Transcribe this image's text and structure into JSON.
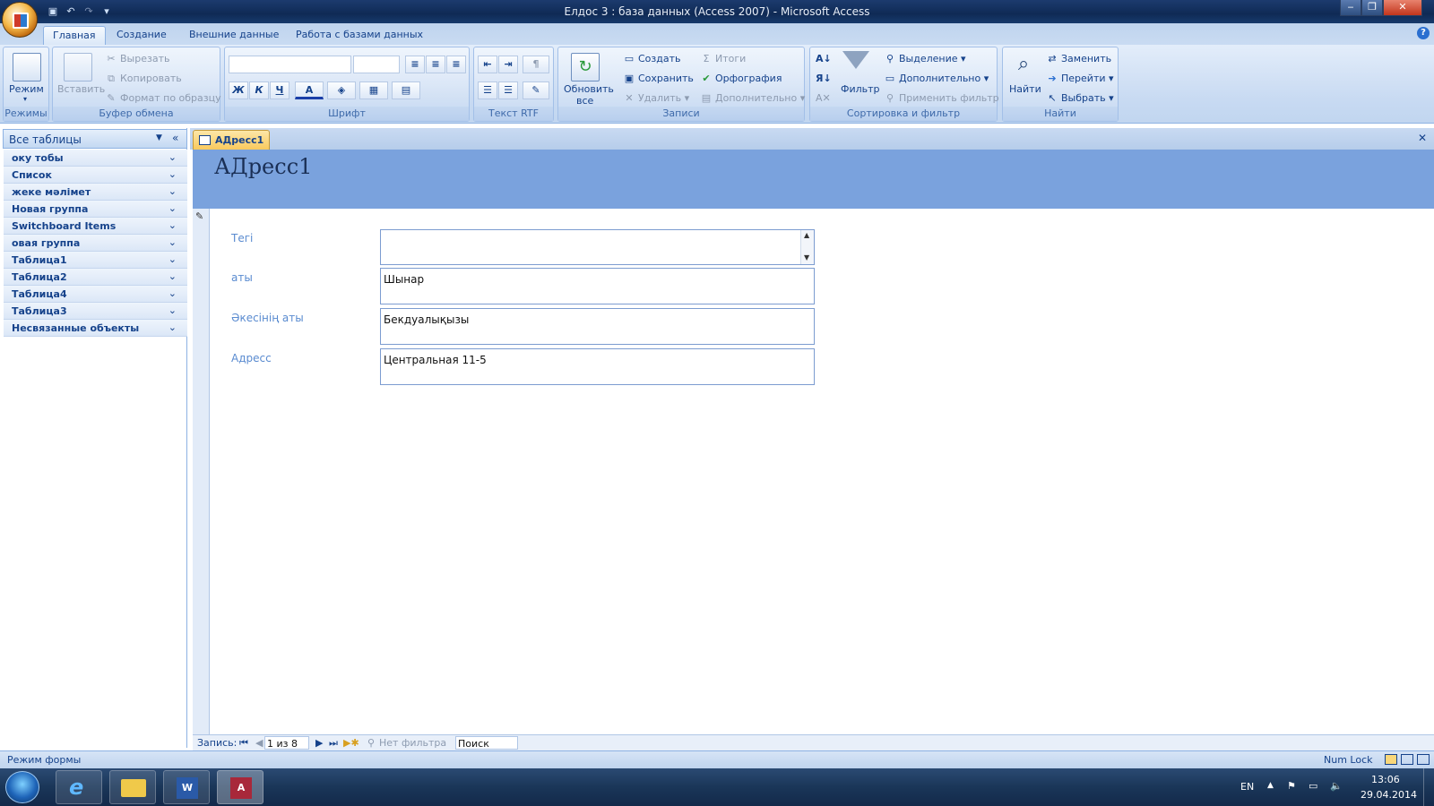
{
  "window": {
    "title": "Елдос 3 : база данных (Access 2007) - Microsoft Access",
    "controls": {
      "minimize": "‒",
      "restore": "❐",
      "close": "✕"
    }
  },
  "quick_access": {
    "save": "save-icon",
    "undo": "undo-icon",
    "redo": "redo-icon",
    "customize": "▾"
  },
  "ribbon_tabs": [
    "Главная",
    "Создание",
    "Внешние данные",
    "Работа с базами данных"
  ],
  "active_tab": "Главная",
  "help": "?",
  "ribbon": {
    "views": {
      "label": "Режимы",
      "mode": "Режим"
    },
    "clipboard": {
      "label": "Буфер обмена",
      "paste": "Вставить",
      "cut": "Вырезать",
      "copy": "Копировать",
      "format_painter": "Формат по образцу"
    },
    "font": {
      "label": "Шрифт",
      "bold": "Ж",
      "italic": "К",
      "underline": "Ч",
      "font_color": "А"
    },
    "rtf": {
      "label": "Текст RTF"
    },
    "records": {
      "label": "Записи",
      "refresh": "Обновить",
      "refresh2": "все",
      "new": "Создать",
      "save": "Сохранить",
      "delete": "Удалить",
      "totals": "Итоги",
      "spelling": "Орфография",
      "more": "Дополнительно"
    },
    "sort_filter": {
      "label": "Сортировка и фильтр",
      "filter": "Фильтр",
      "selection": "Выделение",
      "advanced": "Дополнительно",
      "apply_filter": "Применить фильтр"
    },
    "find": {
      "label": "Найти",
      "find": "Найти",
      "replace": "Заменить",
      "goto": "Перейти",
      "select": "Выбрать"
    }
  },
  "nav_pane": {
    "header": "Все таблицы",
    "collapse": "«",
    "items": [
      "оку тобы",
      "Список",
      "жеке мәлімет",
      "Новая группа",
      "Switchboard Items",
      "овая группа",
      "Таблица1",
      "Таблица2",
      "Таблица4",
      "Таблица3",
      "Несвязанные объекты"
    ]
  },
  "document": {
    "tab": "АДресс1",
    "close": "✕",
    "form_title": "АДресс1",
    "fields": [
      {
        "label": "Тегі",
        "value": ""
      },
      {
        "label": "аты",
        "value": "Шынар"
      },
      {
        "label": "Әкесінің аты",
        "value": "Бекдуалықызы"
      },
      {
        "label": "Адресс",
        "value": "Центральная 11-5"
      }
    ]
  },
  "record_nav": {
    "label": "Запись:",
    "current": "1 из 8",
    "filter": "Нет фильтра",
    "search": "Поиск"
  },
  "status_bar": {
    "mode": "Режим формы",
    "num_lock": "Num Lock"
  },
  "taskbar": {
    "lang": "EN",
    "time": "13:06",
    "date": "29.04.2014"
  }
}
